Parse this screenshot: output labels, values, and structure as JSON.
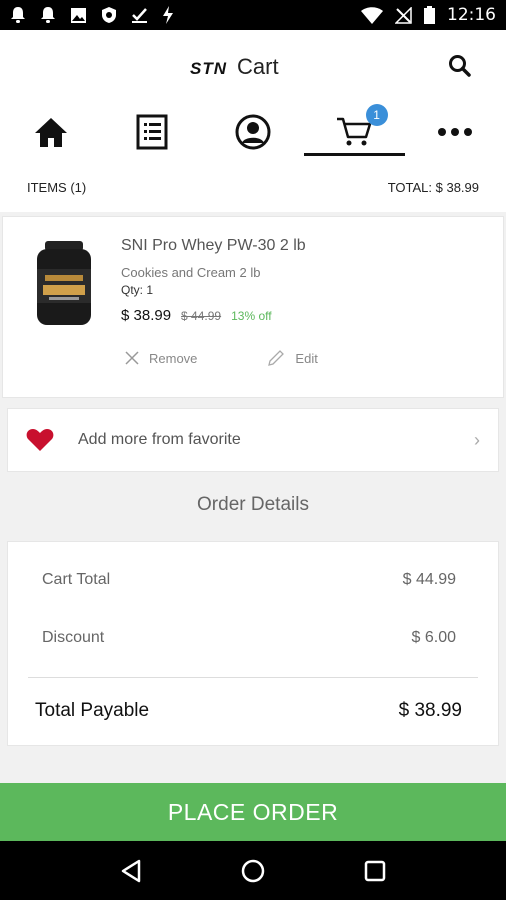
{
  "status_bar": {
    "time": "12:16",
    "left_icons": [
      "notification-bell-icon",
      "notification-bell-icon",
      "image-icon",
      "shield-icon",
      "check-download-icon",
      "flash-icon"
    ],
    "right_icons": [
      "wifi-icon",
      "no-signal-icon",
      "battery-icon"
    ]
  },
  "header": {
    "logo": "STN",
    "title": "Cart",
    "search_icon": "search-icon"
  },
  "nav": {
    "items": [
      {
        "icon": "home-icon",
        "active": false
      },
      {
        "icon": "list-icon",
        "active": false
      },
      {
        "icon": "profile-icon",
        "active": false
      },
      {
        "icon": "cart-icon",
        "active": true,
        "badge": "1"
      },
      {
        "icon": "more-icon",
        "active": false
      }
    ]
  },
  "summary": {
    "items_label": "ITEMS (1)",
    "total_label": "TOTAL: $ 38.99"
  },
  "cart_item": {
    "name": "SNI Pro Whey PW-30 2 lb",
    "variant": "Cookies and Cream 2 lb",
    "qty": "Qty: 1",
    "price": "$ 38.99",
    "old_price": "$ 44.99",
    "discount": "13% off",
    "remove_label": "Remove",
    "edit_label": "Edit"
  },
  "favorite": {
    "label": "Add more from favorite"
  },
  "order": {
    "title": "Order Details",
    "cart_total_label": "Cart Total",
    "cart_total_value": "$ 44.99",
    "discount_label": "Discount",
    "discount_value": "$ 6.00",
    "payable_label": "Total Payable",
    "payable_value": "$ 38.99"
  },
  "place_order_label": "PLACE ORDER",
  "colors": {
    "accent_green": "#5cb85c",
    "badge_blue": "#3a8fd9",
    "heart_red": "#c8102e"
  }
}
